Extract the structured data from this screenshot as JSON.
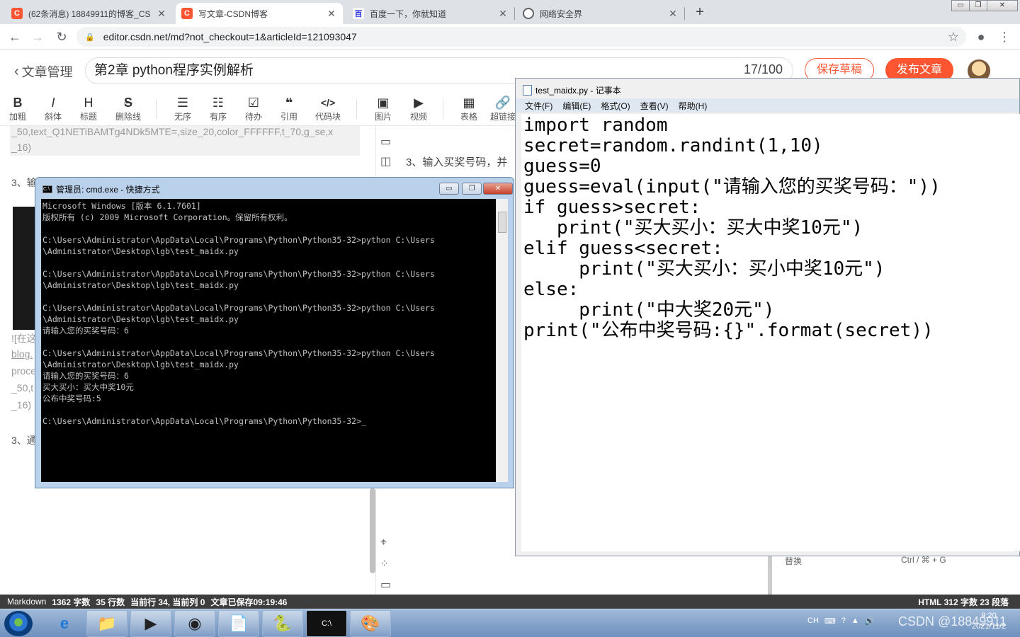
{
  "browser": {
    "tabs": [
      {
        "title": "(62条消息) 18849911的博客_CS",
        "icon": "C"
      },
      {
        "title": "写文章-CSDN博客",
        "icon": "C"
      },
      {
        "title": "百度一下，你就知道",
        "icon": "百"
      },
      {
        "title": "网络安全界",
        "icon": "◎"
      }
    ],
    "new_tab": "+",
    "url": "editor.csdn.net/md?not_checkout=1&articleId=121093047",
    "window_buttons": [
      "▭",
      "❐",
      "✕"
    ]
  },
  "header": {
    "back_label": "文章管理",
    "article_title": "第2章  python程序实例解析",
    "title_count": "17/100",
    "save_draft": "保存草稿",
    "publish": "发布文章"
  },
  "toolbar": {
    "items": [
      {
        "glyph": "B",
        "label": "加粗"
      },
      {
        "glyph": "I",
        "label": "斜体"
      },
      {
        "glyph": "H",
        "label": "标题"
      },
      {
        "glyph": "S",
        "label": "删除线"
      },
      {
        "glyph": "☰",
        "label": "无序"
      },
      {
        "glyph": "☷",
        "label": "有序"
      },
      {
        "glyph": "☑",
        "label": "待办"
      },
      {
        "glyph": "❝",
        "label": "引用"
      },
      {
        "glyph": "</>",
        "label": "代码块"
      },
      {
        "glyph": "▣",
        "label": "图片"
      },
      {
        "glyph": "▶",
        "label": "视频"
      },
      {
        "glyph": "▦",
        "label": "表格"
      },
      {
        "glyph": "🔗",
        "label": "超链接"
      }
    ]
  },
  "editor": {
    "line_top": "_50,text_Q1NETiBAMTg4NDk5MTE=,size_20,color_FFFFFF,t_70,g_se,x",
    "line_top2": "_16)",
    "heading_3": "3、输",
    "frag_1": "![在这",
    "frag_2": "blog.",
    "frag_3": "proce",
    "frag_4": "_50,t",
    "frag_5": "_16)",
    "heading_3b": "3、通",
    "preview_text": "3、输入买奖号码，并"
  },
  "cmd": {
    "title": "管理员: cmd.exe - 快捷方式",
    "output": "Microsoft Windows [版本 6.1.7601]\n版权所有 (c) 2009 Microsoft Corporation。保留所有权利。\n\nC:\\Users\\Administrator\\AppData\\Local\\Programs\\Python\\Python35-32>python C:\\Users\n\\Administrator\\Desktop\\lgb\\test_maidx.py\n\nC:\\Users\\Administrator\\AppData\\Local\\Programs\\Python\\Python35-32>python C:\\Users\n\\Administrator\\Desktop\\lgb\\test_maidx.py\n\nC:\\Users\\Administrator\\AppData\\Local\\Programs\\Python\\Python35-32>python C:\\Users\n\\Administrator\\Desktop\\lgb\\test_maidx.py\n请输入您的买奖号码：6\n\nC:\\Users\\Administrator\\AppData\\Local\\Programs\\Python\\Python35-32>python C:\\Users\n\\Administrator\\Desktop\\lgb\\test_maidx.py\n请输入您的买奖号码：6\n买大买小：买大中奖10元\n公布中奖号码:5\n\nC:\\Users\\Administrator\\AppData\\Local\\Programs\\Python\\Python35-32>_"
  },
  "notepad": {
    "title": "test_maidx.py - 记事本",
    "menu": [
      "文件(F)",
      "编辑(E)",
      "格式(O)",
      "查看(V)",
      "帮助(H)"
    ],
    "content": "import random\nsecret=random.randint(1,10)\nguess=0\nguess=eval(input(\"请输入您的买奖号码：\"))\nif guess>secret:\n   print(\"买大买小：买大中奖10元\")\nelif guess<secret:\n     print(\"买大买小：买小中奖10元\")\nelse:\n     print(\"中大奖20元\")\nprint(\"公布中奖号码:{}\".format(secret))"
  },
  "behind": {
    "replace_label": "替换",
    "replace_key": "Ctrl / ⌘ + G"
  },
  "statusbar": {
    "left": [
      "Markdown",
      "1362 字数",
      "35 行数",
      "当前行 34, 当前列 0",
      "文章已保存09:19:46"
    ],
    "right": "HTML  312 字数  23 段落"
  },
  "taskbar": {
    "tray": [
      "CH",
      "⌨",
      "?",
      "▲",
      "🔊"
    ],
    "time": "9:20",
    "date": "2021/11/2",
    "watermark": "CSDN @18849911"
  }
}
